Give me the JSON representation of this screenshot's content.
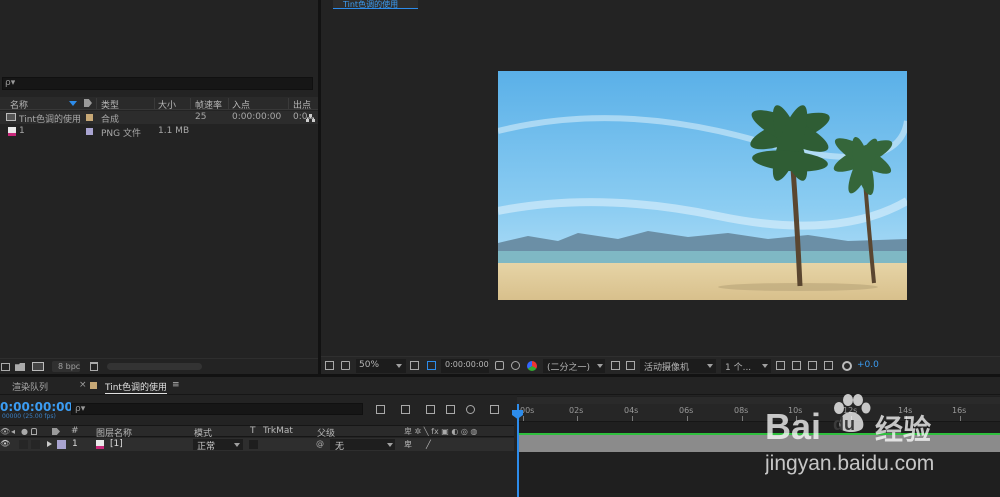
{
  "project_panel": {
    "search_placeholder": "ρ▾",
    "columns": {
      "name": "名称",
      "type": "类型",
      "size": "大小",
      "framerate": "帧速率",
      "in_point": "入点",
      "out_point": "出点"
    },
    "items": [
      {
        "name": "Tint色调的使用",
        "type": "合成",
        "size": "",
        "framerate": "25",
        "in_point": "0:00:00:00",
        "out_point": "0:0",
        "swatch": "#c7a876"
      },
      {
        "name": "1",
        "type": "PNG 文件",
        "size": "1.1 MB",
        "framerate": "",
        "in_point": "",
        "out_point": "",
        "swatch": "#a9a4d1"
      }
    ],
    "footer_bpc": "8 bpc"
  },
  "viewer": {
    "tab_label": "Tint色调的使用",
    "zoom": "50%",
    "timecode": "0:00:00:00",
    "resolution": "(二分之一)",
    "camera": "活动摄像机",
    "views": "1 个...",
    "exposure": "+0.0"
  },
  "timeline": {
    "tab_render_queue": "渲染队列",
    "tab_comp": "Tint色调的使用",
    "current_time": "0:00:00:00",
    "frame_info": "00000 (25.00 fps)",
    "search_placeholder": "ρ▾",
    "columns": {
      "number": "#",
      "layer_name": "图层名称",
      "mode": "模式",
      "t": "T",
      "trkmat": "TrkMat",
      "parent": "父级"
    },
    "layers": [
      {
        "number": "1",
        "name": "[1]",
        "mode": "正常",
        "parent": "无"
      }
    ],
    "ruler_labels": [
      "00s",
      "02s",
      "04s",
      "06s",
      "08s",
      "10s",
      "12s",
      "14s",
      "16s"
    ],
    "colors": {
      "accent": "#2d8ceb",
      "track_green": "#2fbf3e",
      "layer_swatch": "#a9a4d1"
    }
  },
  "watermark": {
    "brand_bai": "Bai",
    "brand_du": "du",
    "brand_cn": "经验",
    "url": "jingyan.baidu.com"
  }
}
